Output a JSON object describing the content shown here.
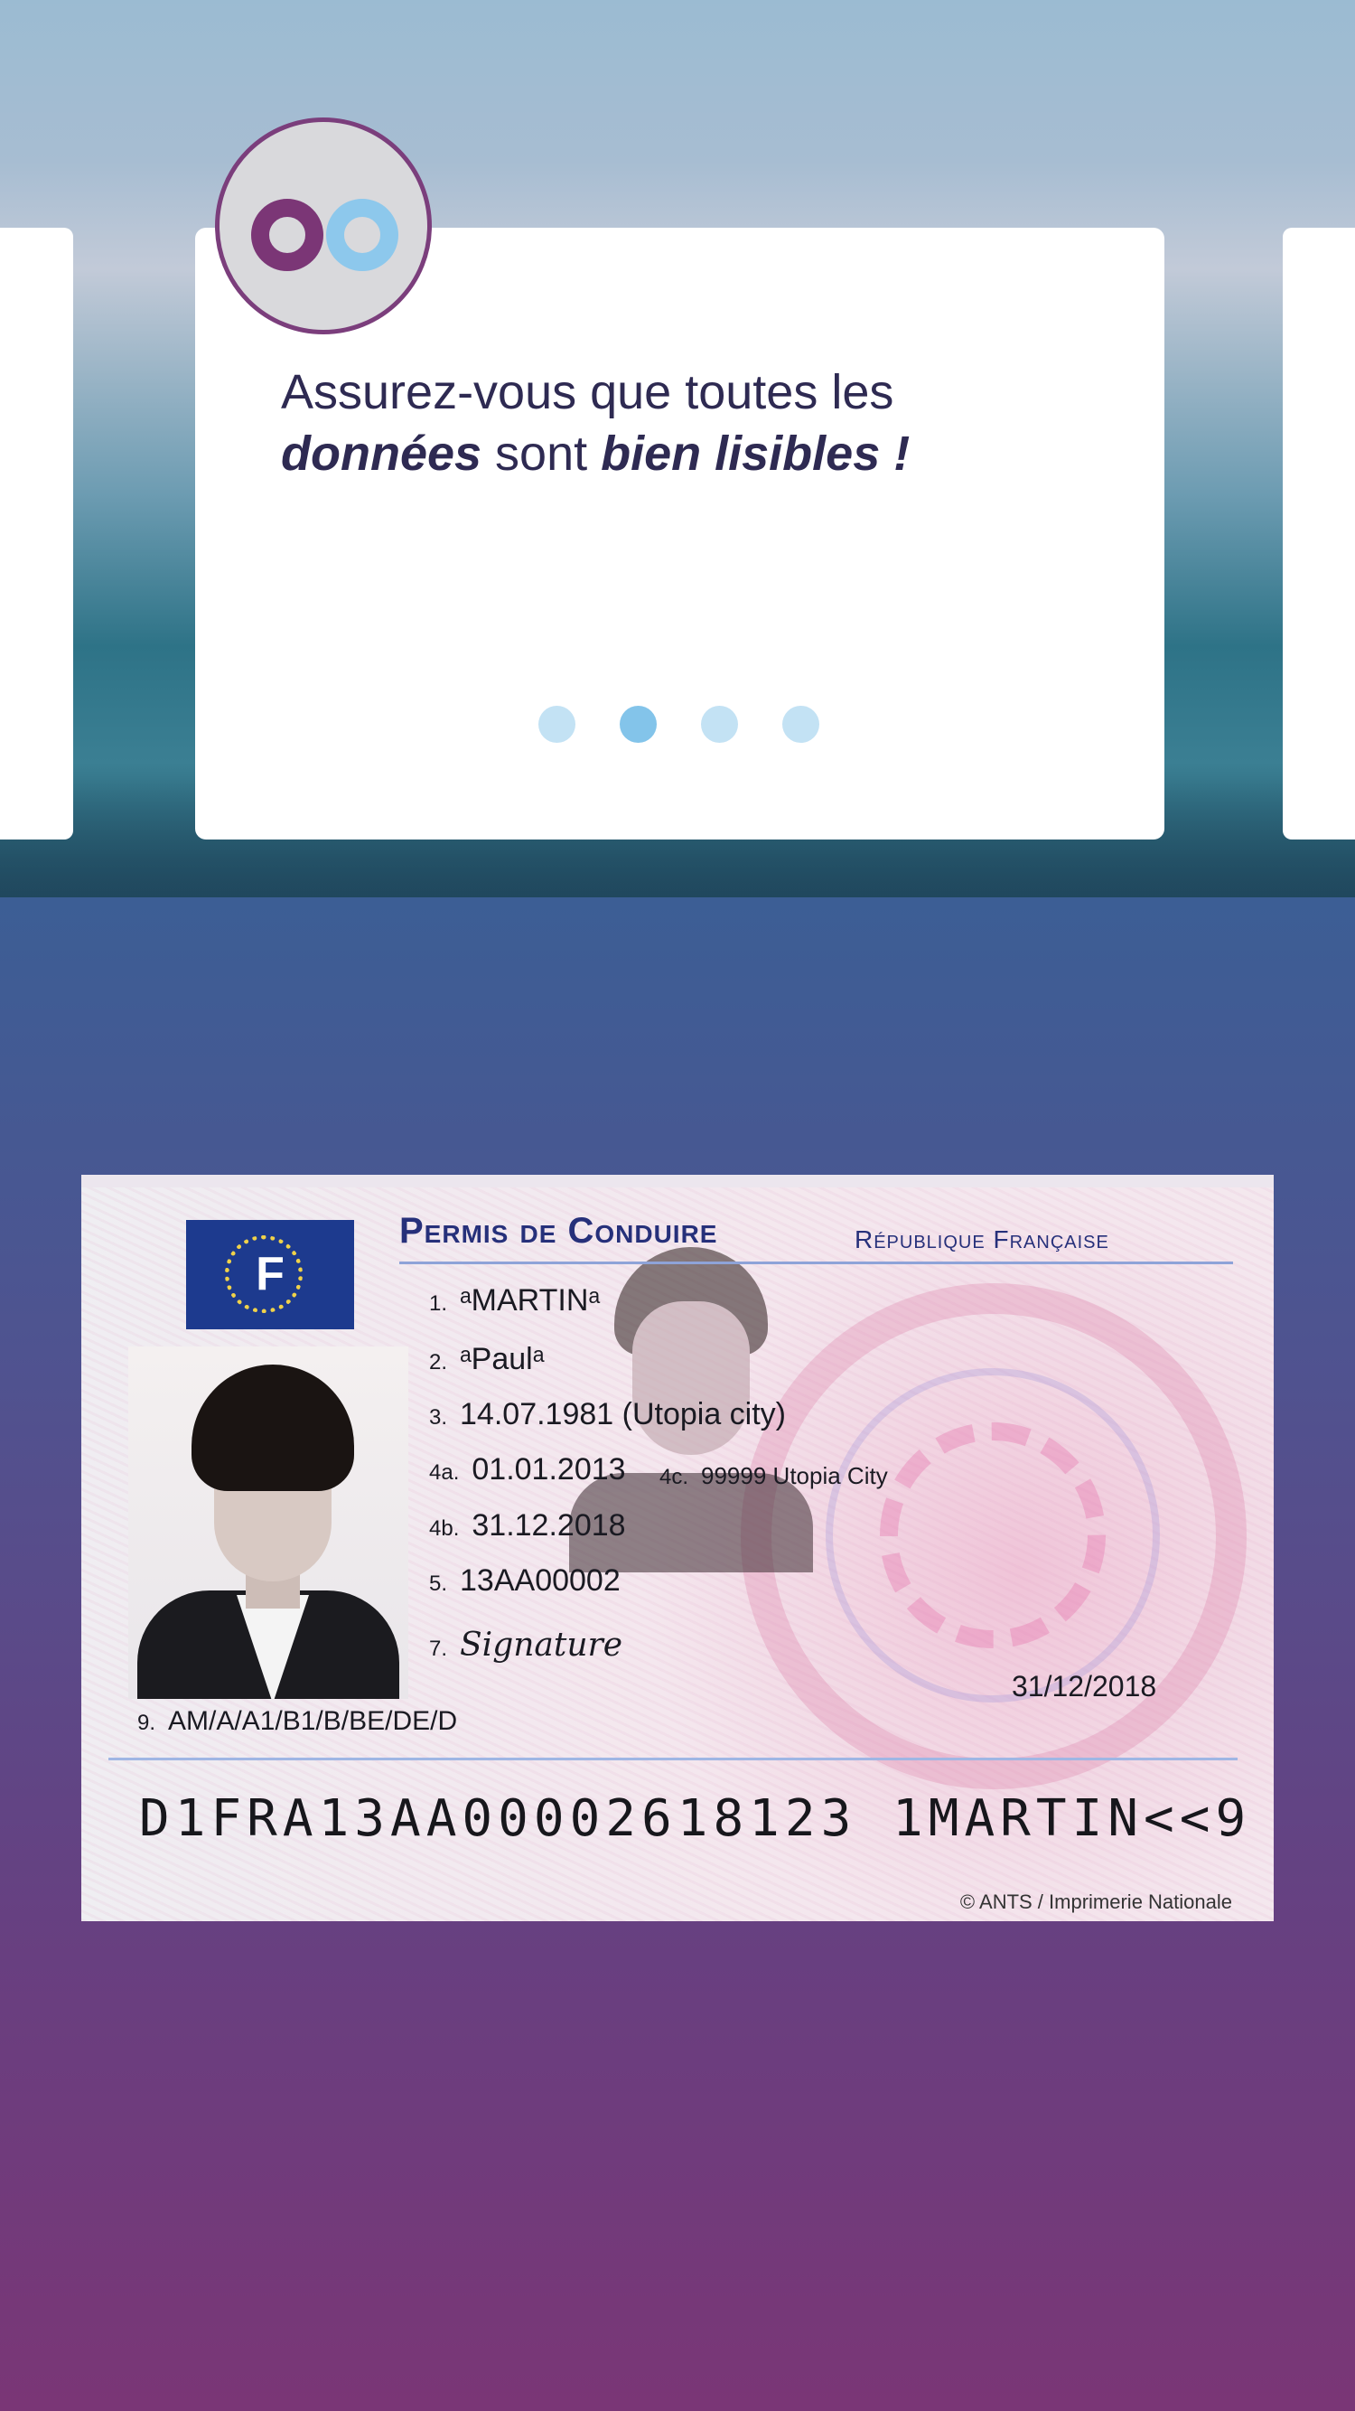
{
  "tutorial": {
    "message_part1": "Assurez-vous que toutes les",
    "message_bold1": "données",
    "message_part2": " sont ",
    "message_bold2": "bien lisibles !",
    "pagination": {
      "total": 4,
      "active_index": 1
    }
  },
  "license": {
    "title": "Permis de Conduire",
    "republic": "République Française",
    "flag_letter": "F",
    "fields": {
      "f1_num": "1.",
      "f1_val": "ᵃMARTINᵃ",
      "f2_num": "2.",
      "f2_val": "ᵃPaulᵃ",
      "f3_num": "3.",
      "f3_val": "14.07.1981 (Utopia city)",
      "f4a_num": "4a.",
      "f4a_val": "01.01.2013",
      "f4c_num": "4c.",
      "f4c_val": "99999 Utopia City",
      "f4b_num": "4b.",
      "f4b_val": "31.12.2018",
      "f5_num": "5.",
      "f5_val": "13AA00002",
      "f7_num": "7.",
      "f7_val": "Signature",
      "date": "31/12/2018",
      "f9_num": "9.",
      "f9_val": "AM/A/A1/B1/B/BE/DE/D"
    },
    "mrz": "D1FRA13AA00002618123 1MARTIN<<9",
    "credit": "© ANTS / Imprimerie Nationale"
  },
  "colors": {
    "brand_purple": "#7b3676",
    "brand_blue": "#8dc8ec",
    "text_dark": "#2e2a52"
  }
}
